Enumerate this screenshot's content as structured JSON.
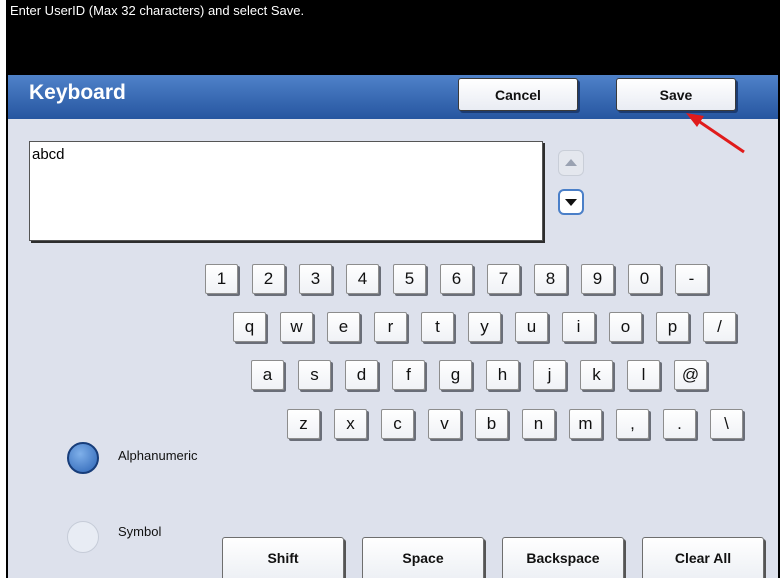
{
  "instruction": "Enter UserID (Max 32 characters) and select Save.",
  "header": {
    "title": "Keyboard",
    "cancel_label": "Cancel",
    "save_label": "Save"
  },
  "input": {
    "value": "abcd"
  },
  "keyboard": {
    "row1": [
      "1",
      "2",
      "3",
      "4",
      "5",
      "6",
      "7",
      "8",
      "9",
      "0",
      "-"
    ],
    "row2": [
      "q",
      "w",
      "e",
      "r",
      "t",
      "y",
      "u",
      "i",
      "o",
      "p",
      "/"
    ],
    "row3": [
      "a",
      "s",
      "d",
      "f",
      "g",
      "h",
      "j",
      "k",
      "l",
      "@"
    ],
    "row4": [
      "z",
      "x",
      "c",
      "v",
      "b",
      "n",
      "m",
      ",",
      ".",
      "\\"
    ]
  },
  "modes": {
    "alphanumeric_label": "Alphanumeric",
    "symbol_label": "Symbol",
    "selected": "Alphanumeric"
  },
  "bottom": {
    "shift_label": "Shift",
    "space_label": "Space",
    "backspace_label": "Backspace",
    "clear_all_label": "Clear All"
  },
  "colors": {
    "header_blue": "#2f63ad",
    "background": "#dde1ec",
    "annotation_arrow": "#e01b1b"
  },
  "icons": {
    "scroll_up": "triangle-up-icon",
    "scroll_down": "triangle-down-icon"
  }
}
